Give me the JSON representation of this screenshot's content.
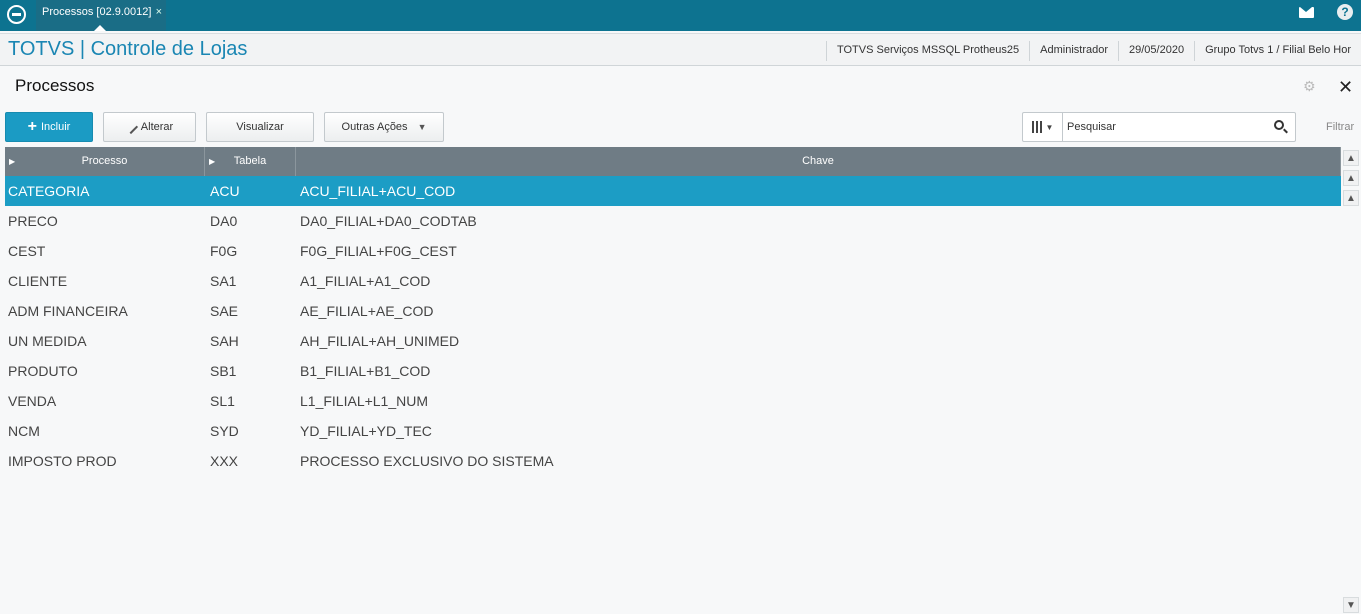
{
  "topbar": {
    "tab_label": "Processos [02.9.0012]",
    "tab_close": "×",
    "help_label": "?"
  },
  "header": {
    "app_title": "TOTVS | Controle de Lojas",
    "server": "TOTVS Serviços MSSQL Protheus25",
    "user": "Administrador",
    "date": "29/05/2020",
    "branch": "Grupo Totvs 1 / Filial Belo Hor"
  },
  "page": {
    "title": "Processos",
    "close": "✕",
    "gear": "⚙"
  },
  "toolbar": {
    "include": "Incluir",
    "include_plus": "+",
    "edit": "Alterar",
    "view": "Visualizar",
    "other": "Outras Ações",
    "other_caret": "▼"
  },
  "search": {
    "placeholder": "Pesquisar",
    "filter": "Filtrar"
  },
  "grid": {
    "columns": [
      "Processo",
      "Tabela",
      "Chave"
    ],
    "rows": [
      {
        "processo": "CATEGORIA",
        "tabela": "ACU",
        "chave": "ACU_FILIAL+ACU_COD"
      },
      {
        "processo": "PRECO",
        "tabela": "DA0",
        "chave": "DA0_FILIAL+DA0_CODTAB"
      },
      {
        "processo": "CEST",
        "tabela": "F0G",
        "chave": "F0G_FILIAL+F0G_CEST"
      },
      {
        "processo": "CLIENTE",
        "tabela": "SA1",
        "chave": "A1_FILIAL+A1_COD"
      },
      {
        "processo": "ADM FINANCEIRA",
        "tabela": "SAE",
        "chave": "AE_FILIAL+AE_COD"
      },
      {
        "processo": "UN MEDIDA",
        "tabela": "SAH",
        "chave": "AH_FILIAL+AH_UNIMED"
      },
      {
        "processo": "PRODUTO",
        "tabela": "SB1",
        "chave": "B1_FILIAL+B1_COD"
      },
      {
        "processo": "VENDA",
        "tabela": "SL1",
        "chave": "L1_FILIAL+L1_NUM"
      },
      {
        "processo": "NCM",
        "tabela": "SYD",
        "chave": "YD_FILIAL+YD_TEC"
      },
      {
        "processo": "IMPOSTO PROD",
        "tabela": "XXX",
        "chave": "PROCESSO EXCLUSIVO DO SISTEMA"
      }
    ]
  },
  "colors": {
    "topbar": "#0d7390",
    "accent": "#1b9bc4",
    "grid_header": "#6f7c85"
  }
}
